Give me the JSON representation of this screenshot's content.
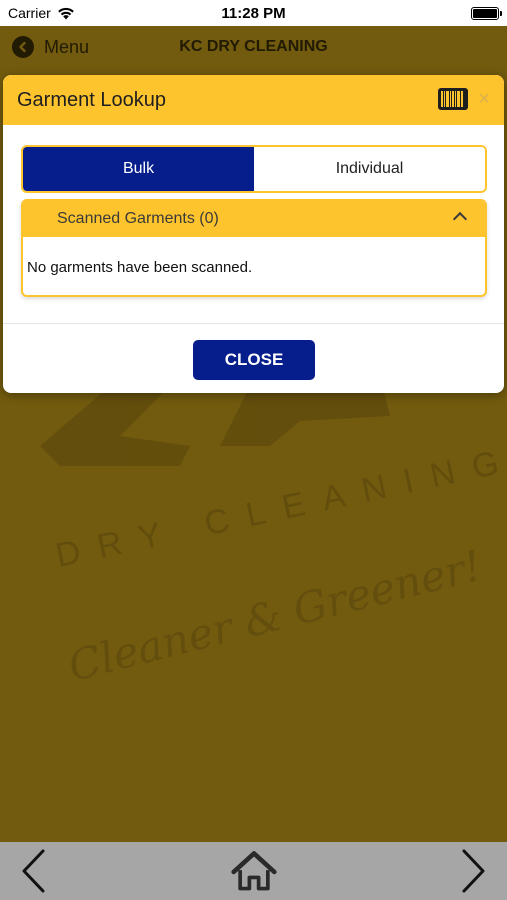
{
  "status_bar": {
    "carrier": "Carrier",
    "time": "11:28 PM"
  },
  "nav": {
    "back_label": "Menu",
    "title": "KC DRY CLEANING"
  },
  "watermark": {
    "line1": "DRY CLEANING",
    "line2": "Cleaner & Greener!"
  },
  "modal": {
    "title": "Garment Lookup",
    "tabs": [
      {
        "label": "Bulk",
        "active": true
      },
      {
        "label": "Individual",
        "active": false
      }
    ],
    "panel": {
      "header": "Scanned Garments (0)",
      "empty_message": "No garments have been scanned."
    },
    "close_button": "CLOSE"
  },
  "colors": {
    "accent_yellow": "#fec42d",
    "primary_blue": "#051e8c",
    "background_gold": "#8c6f12",
    "toolbar_gray": "#a6a6a6"
  },
  "icons": {
    "back": "chevron-left-circle-icon",
    "barcode": "barcode-scanner-icon",
    "close": "close-icon",
    "collapse": "chevron-up-icon",
    "prev": "chevron-left-icon",
    "home": "home-icon",
    "next": "chevron-right-icon"
  }
}
